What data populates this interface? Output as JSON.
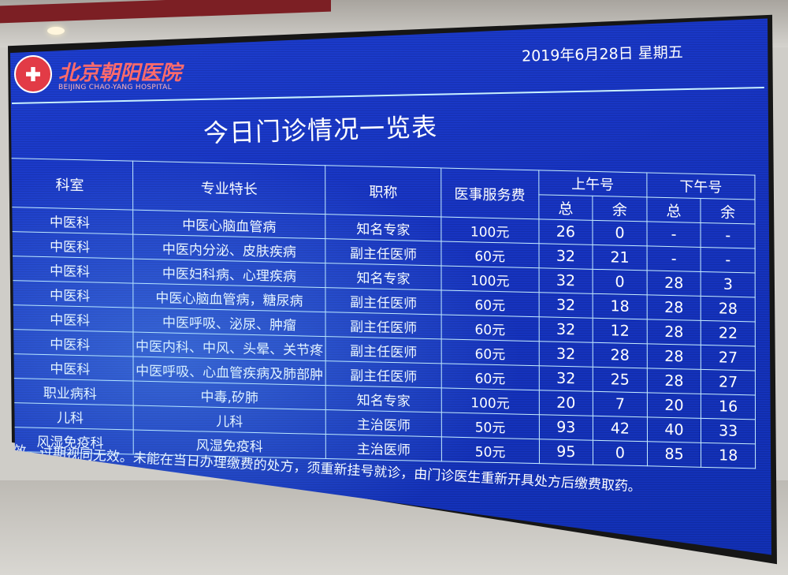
{
  "hospital": {
    "name_cn": "北京朝阳医院",
    "name_en": "BEIJING CHAO-YANG HOSPITAL"
  },
  "date": "2019年6月28日 星期五",
  "title": "今日门诊情况一览表",
  "table": {
    "headers": {
      "department": "科室",
      "specialty": "专业特长",
      "rank": "职称",
      "fee": "医事服务费",
      "morning": "上午号",
      "afternoon": "下午号",
      "total": "总",
      "remaining": "余"
    },
    "rows": [
      {
        "department": "中医科",
        "specialty": "中医心脑血管病",
        "rank": "知名专家",
        "fee": "100元",
        "am_total": "26",
        "am_remaining": "0",
        "pm_total": "-",
        "pm_remaining": "-"
      },
      {
        "department": "中医科",
        "specialty": "中医内分泌、皮肤疾病",
        "rank": "副主任医师",
        "fee": "60元",
        "am_total": "32",
        "am_remaining": "21",
        "pm_total": "-",
        "pm_remaining": "-"
      },
      {
        "department": "中医科",
        "specialty": "中医妇科病、心理疾病",
        "rank": "知名专家",
        "fee": "100元",
        "am_total": "32",
        "am_remaining": "0",
        "pm_total": "28",
        "pm_remaining": "3"
      },
      {
        "department": "中医科",
        "specialty": "中医心脑血管病，糖尿病",
        "rank": "副主任医师",
        "fee": "60元",
        "am_total": "32",
        "am_remaining": "18",
        "pm_total": "28",
        "pm_remaining": "28"
      },
      {
        "department": "中医科",
        "specialty": "中医呼吸、泌尿、肿瘤",
        "rank": "副主任医师",
        "fee": "60元",
        "am_total": "32",
        "am_remaining": "12",
        "pm_total": "28",
        "pm_remaining": "22"
      },
      {
        "department": "中医科",
        "specialty": "中医内科、中风、头晕、关节疼",
        "rank": "副主任医师",
        "fee": "60元",
        "am_total": "32",
        "am_remaining": "28",
        "pm_total": "28",
        "pm_remaining": "27"
      },
      {
        "department": "中医科",
        "specialty": "中医呼吸、心血管疾病及肺部肿",
        "rank": "副主任医师",
        "fee": "60元",
        "am_total": "32",
        "am_remaining": "25",
        "pm_total": "28",
        "pm_remaining": "27"
      },
      {
        "department": "职业病科",
        "specialty": "中毒,矽肺",
        "rank": "知名专家",
        "fee": "100元",
        "am_total": "20",
        "am_remaining": "7",
        "pm_total": "20",
        "pm_remaining": "16"
      },
      {
        "department": "儿科",
        "specialty": "儿科",
        "rank": "主治医师",
        "fee": "50元",
        "am_total": "93",
        "am_remaining": "42",
        "pm_total": "40",
        "pm_remaining": "33"
      },
      {
        "department": "风湿免疫科",
        "specialty": "风湿免疫科",
        "rank": "主治医师",
        "fee": "50元",
        "am_total": "95",
        "am_remaining": "0",
        "pm_total": "85",
        "pm_remaining": "18"
      }
    ]
  },
  "notice": "有效，过期视同无效。未能在当日办理缴费的处方，须重新挂号就诊，由门诊医生重新开具处方后缴费取药。",
  "colors": {
    "screen": "#1734c2",
    "grid": "#c8efff",
    "text": "#ffffff",
    "logo": "#e23b46"
  }
}
